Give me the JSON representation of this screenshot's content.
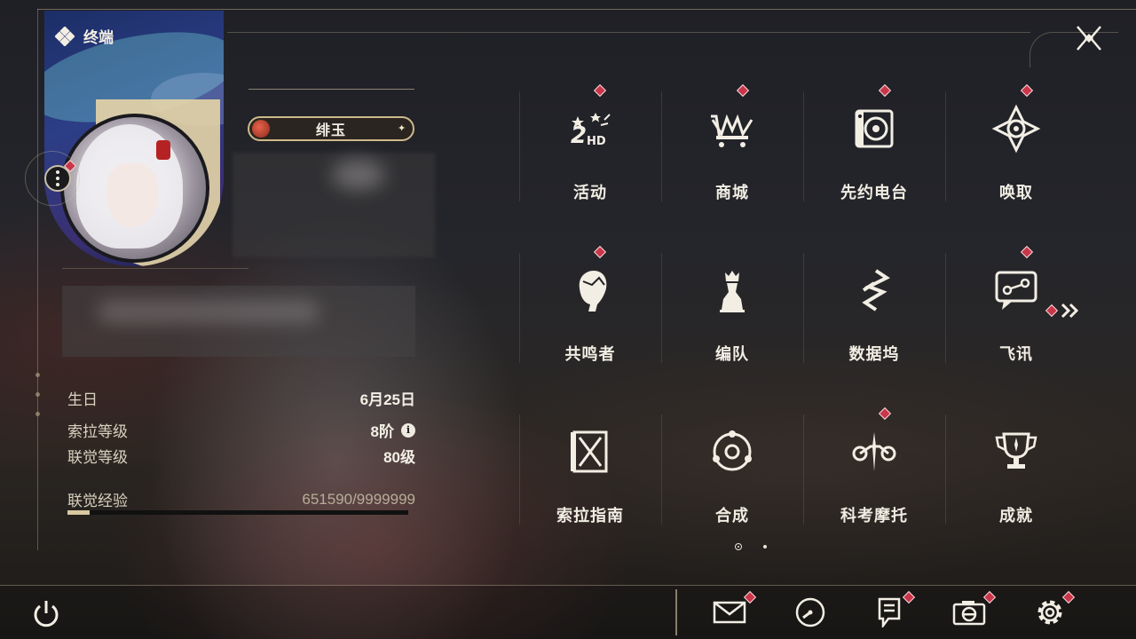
{
  "header": {
    "title": "终端"
  },
  "profile": {
    "name": "绯玉",
    "stats": [
      {
        "label": "生日",
        "value": "6月25日"
      },
      {
        "label": "索拉等级",
        "value": "8阶"
      },
      {
        "label": "联觉等级",
        "value": "80级"
      }
    ],
    "exp": {
      "label": "联觉经验",
      "value": "651590/9999999",
      "progress": 0.065
    }
  },
  "menu": {
    "items": [
      {
        "label": "活动",
        "icon": "event-2hd-icon",
        "badge": true
      },
      {
        "label": "商城",
        "icon": "shop-crown-cart-icon",
        "badge": true
      },
      {
        "label": "先约电台",
        "icon": "radio-icon",
        "badge": true
      },
      {
        "label": "唤取",
        "icon": "convene-compass-icon",
        "badge": true
      },
      {
        "label": "共鸣者",
        "icon": "resonator-head-icon",
        "badge": true
      },
      {
        "label": "编队",
        "icon": "team-chess-icon",
        "badge": false
      },
      {
        "label": "数据坞",
        "icon": "data-bank-icon",
        "badge": false
      },
      {
        "label": "飞讯",
        "icon": "message-chat-icon",
        "badge": true
      },
      {
        "label": "索拉指南",
        "icon": "guidebook-icon",
        "badge": false
      },
      {
        "label": "合成",
        "icon": "synthesis-icon",
        "badge": false
      },
      {
        "label": "科考摩托",
        "icon": "motorbike-icon",
        "badge": true
      },
      {
        "label": "成就",
        "icon": "trophy-icon",
        "badge": false
      }
    ],
    "pages": {
      "current": 1,
      "total": 2
    }
  },
  "bottom_bar": {
    "buttons": [
      {
        "icon": "mail-icon",
        "badge": true
      },
      {
        "icon": "clock-icon",
        "badge": false
      },
      {
        "icon": "notice-icon",
        "badge": true
      },
      {
        "icon": "camera-icon",
        "badge": true
      },
      {
        "icon": "settings-gear-icon",
        "badge": true
      }
    ]
  },
  "colors": {
    "accent_gold": "#cdb98a",
    "badge_red": "#c9364a",
    "text_light": "#f1ede3"
  }
}
